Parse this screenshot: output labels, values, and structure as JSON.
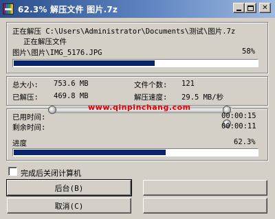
{
  "window": {
    "title": "62.3% 解压文件 图片.7z",
    "controls": {
      "minimize": "",
      "maximize": "",
      "close": "✕"
    }
  },
  "extract": {
    "dest_line": "正在解压 C:\\Users\\Administrator\\Documents\\测试\\图片.7z",
    "status_line": "正在解压文件",
    "current_file": "图片\\图片\\IMG_5176.JPG",
    "file_percent_text": "58%",
    "file_progress": 0.58
  },
  "stats": {
    "total_size_label": "总大小:",
    "total_size_value": "753.6 MB",
    "file_count_label": "文件个数:",
    "file_count_value": "121",
    "extracted_label": "已解压:",
    "extracted_value": "469.8 MB",
    "speed_label": "解压速度:",
    "speed_value": "29.5 MB/秒"
  },
  "time": {
    "elapsed_label": "已用时间:",
    "elapsed_value": "00:00:15",
    "remaining_label": "剩余时间:",
    "remaining_value": "00:00:11",
    "progress_label": "进度",
    "progress_text": "62.3%",
    "overall_progress": 0.623
  },
  "watermark": {
    "text": "www.qinpinchang.com"
  },
  "options": {
    "shutdown_label": "完成后关闭计算机",
    "shutdown_checked": false
  },
  "buttons": {
    "background_label": "后台(B)",
    "cancel_label": "取消(C)",
    "right_top_label": "",
    "right_bottom_label": ""
  },
  "colors": {
    "progress_fill": "#0a246a",
    "watermark_text": "#e00000",
    "dialog_bg": "#d4d0c8"
  }
}
